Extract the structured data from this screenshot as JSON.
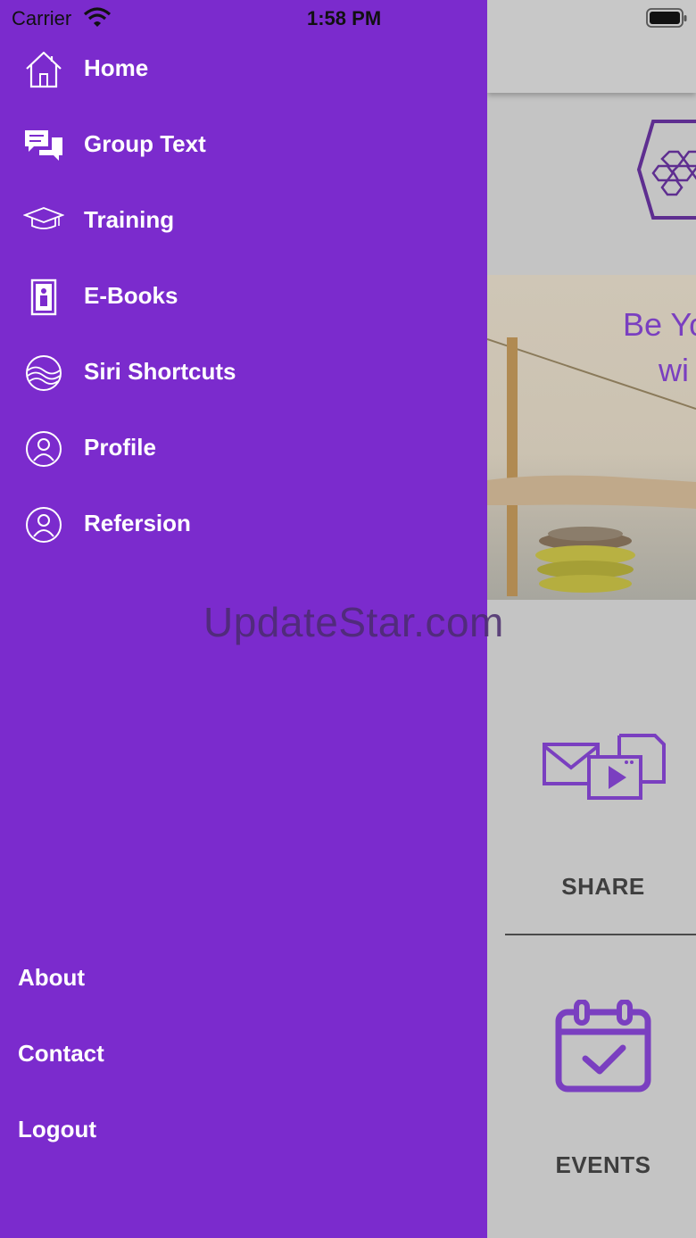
{
  "status_bar": {
    "carrier": "Carrier",
    "time": "1:58 PM"
  },
  "drawer": {
    "background": "#7b2bcd",
    "menu": [
      {
        "label": "Home",
        "icon": "home-icon"
      },
      {
        "label": "Group Text",
        "icon": "chat-bubbles-icon"
      },
      {
        "label": "Training",
        "icon": "graduation-cap-icon"
      },
      {
        "label": "E-Books",
        "icon": "ebook-icon"
      },
      {
        "label": "Siri Shortcuts",
        "icon": "siri-waves-icon"
      },
      {
        "label": "Profile",
        "icon": "user-circle-icon"
      },
      {
        "label": "Refersion",
        "icon": "user-circle-icon"
      }
    ],
    "footer": [
      {
        "label": "About"
      },
      {
        "label": "Contact"
      },
      {
        "label": "Logout"
      }
    ]
  },
  "background_app": {
    "banner_line1": "Be Yo",
    "banner_line2": "wi",
    "share_label": "SHARE",
    "events_label": "EVENTS",
    "accent": "#7a3fc0"
  },
  "watermark": "UpdateStar.com"
}
